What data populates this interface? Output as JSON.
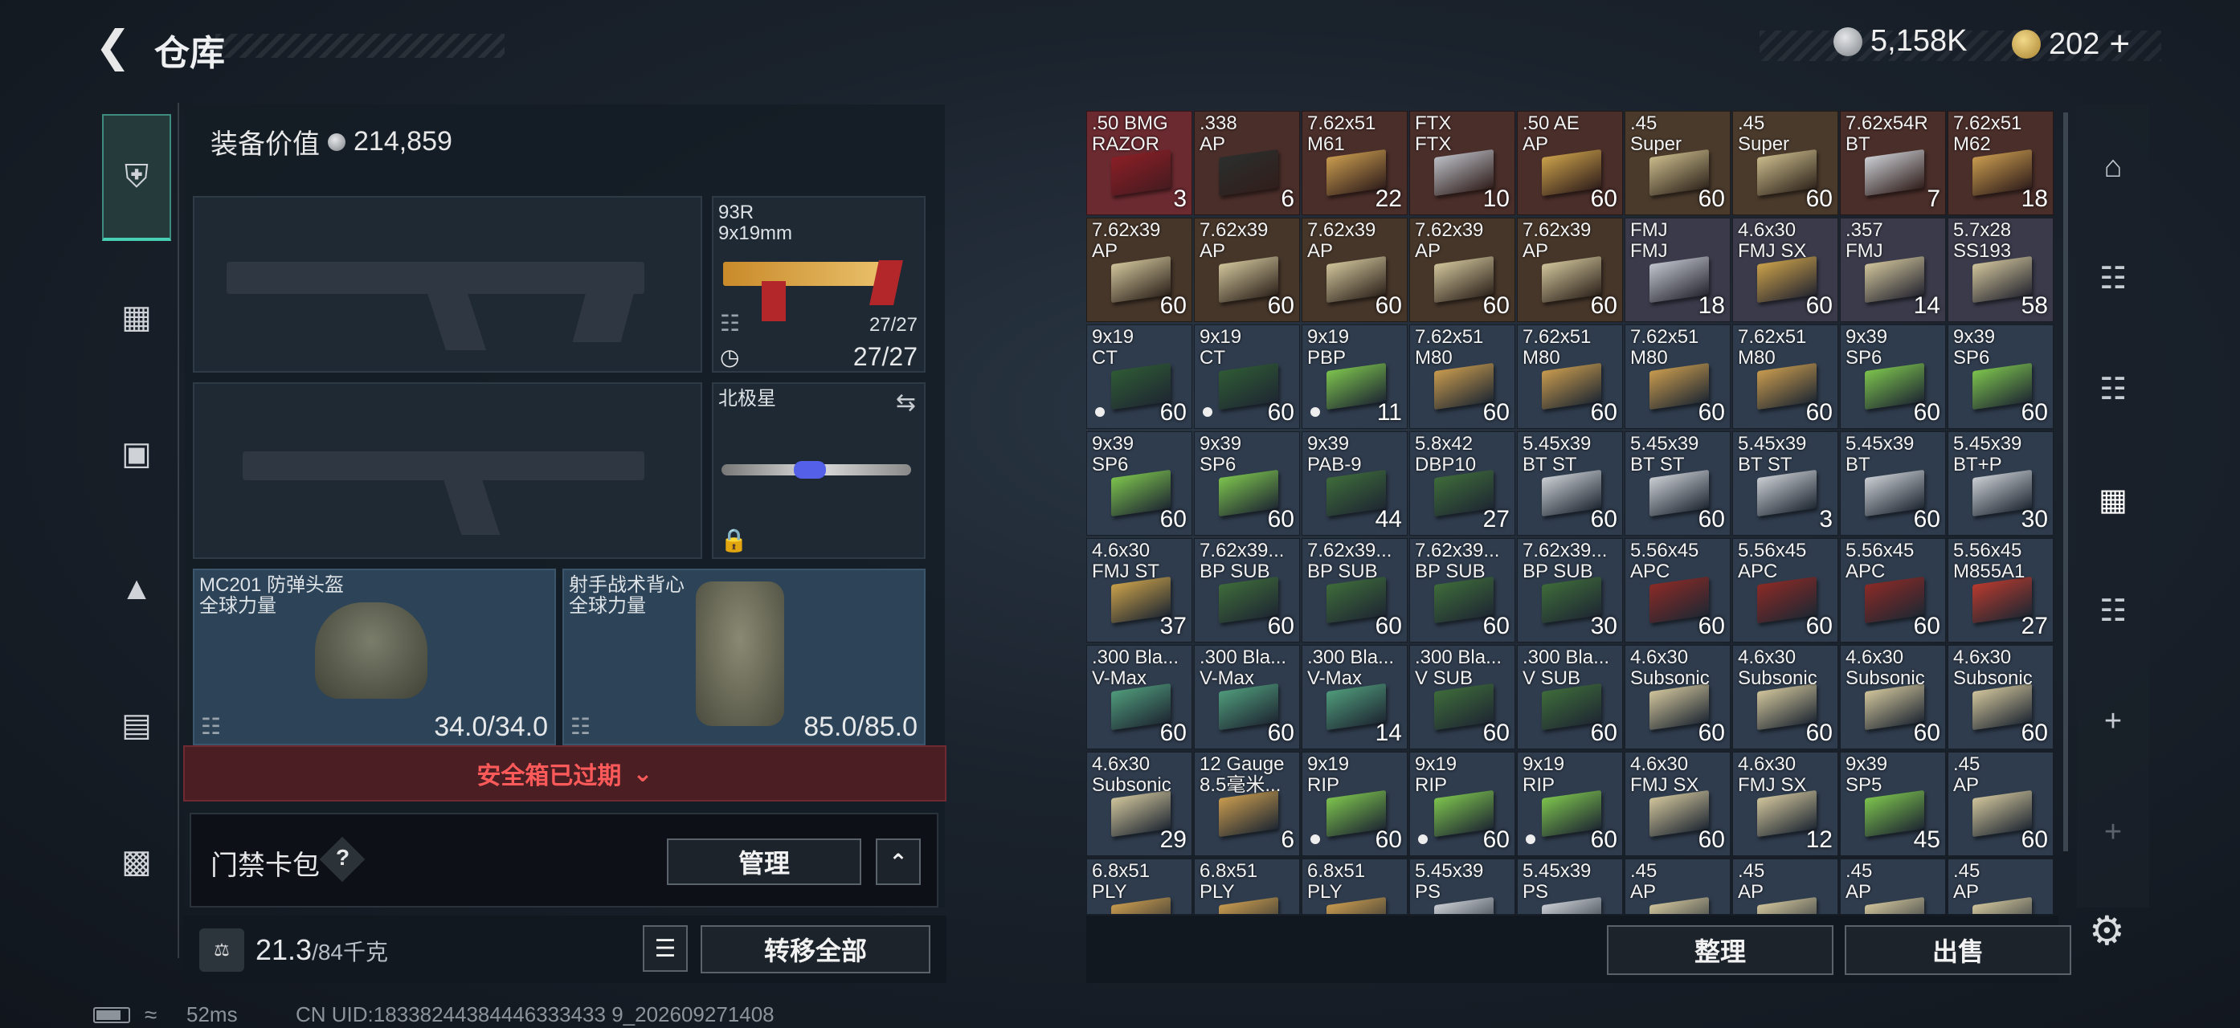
{
  "header": {
    "title": "仓库",
    "currency1": "5,158K",
    "currency2": "202"
  },
  "equipment": {
    "value_label": "装备价值",
    "value": "214,859",
    "pistol": {
      "name1": "93R",
      "name2": "9x19mm",
      "ammo_small": "27/27",
      "ammo": "27/27"
    },
    "melee": {
      "name": "北极星"
    },
    "helmet": {
      "name": "MC201 防弹头盔",
      "brand": "全球力量",
      "durability": "34.0/34.0"
    },
    "vest": {
      "name": "射手战术背心",
      "brand": "全球力量",
      "durability": "85.0/85.0"
    },
    "safe_box": "安全箱已过期",
    "access_card": "门禁卡包",
    "access_help": "?",
    "manage": "管理",
    "weight": "21.3",
    "weight_max": "/84千克",
    "transfer_all": "转移全部"
  },
  "actions": {
    "organize": "整理",
    "sell": "出售"
  },
  "status": {
    "ping": "52ms",
    "uid": "CN UID:18338244384446333433 9_202609271408"
  },
  "colors": {
    "accent": "#47d0b3",
    "danger": "#ff5a5a"
  },
  "grid": [
    {
      "n1": ".50 BMG",
      "n2": "RAZOR",
      "q": "3",
      "bg": "#6b2a30",
      "c": "#8b1e26"
    },
    {
      "n1": ".338",
      "n2": "AP",
      "q": "6",
      "bg": "#4a2e2a",
      "c": "#2b2f2d"
    },
    {
      "n1": "7.62x51",
      "n2": "M61",
      "q": "22",
      "bg": "#4a2e2a",
      "c": "#c79a4e"
    },
    {
      "n1": "FTX",
      "n2": "FTX",
      "q": "10",
      "bg": "#4a2e2a",
      "c": "#b9bdc4"
    },
    {
      "n1": ".50 AE",
      "n2": "AP",
      "q": "60",
      "bg": "#4a2e2a",
      "c": "#c9a04a"
    },
    {
      "n1": ".45",
      "n2": "Super",
      "q": "60",
      "bg": "#4a3a2c",
      "c": "#c8b98a"
    },
    {
      "n1": ".45",
      "n2": "Super",
      "q": "60",
      "bg": "#4a3a2c",
      "c": "#c8b98a"
    },
    {
      "n1": "7.62x54R",
      "n2": "BT",
      "q": "7",
      "bg": "#4a2e2a",
      "c": "#c9cdd2"
    },
    {
      "n1": "7.62x51",
      "n2": "M62",
      "q": "18",
      "bg": "#4a2e2a",
      "c": "#c79a4e"
    },
    {
      "n1": "7.62x39",
      "n2": "AP",
      "q": "60",
      "bg": "#46362a",
      "c": "#cfc39a"
    },
    {
      "n1": "7.62x39",
      "n2": "AP",
      "q": "60",
      "bg": "#46362a",
      "c": "#cfc39a"
    },
    {
      "n1": "7.62x39",
      "n2": "AP",
      "q": "60",
      "bg": "#46362a",
      "c": "#cfc39a"
    },
    {
      "n1": "7.62x39",
      "n2": "AP",
      "q": "60",
      "bg": "#46362a",
      "c": "#cfc39a"
    },
    {
      "n1": "7.62x39",
      "n2": "AP",
      "q": "60",
      "bg": "#46362a",
      "c": "#cfc39a"
    },
    {
      "n1": "FMJ",
      "n2": "FMJ",
      "q": "18",
      "bg": "#3a3a4a",
      "c": "#bfc3cc"
    },
    {
      "n1": "4.6x30",
      "n2": "FMJ SX",
      "q": "60",
      "bg": "#3a3a4a",
      "c": "#c9a04a"
    },
    {
      "n1": ".357",
      "n2": "FMJ",
      "q": "14",
      "bg": "#3a3a4a",
      "c": "#cfc39a"
    },
    {
      "n1": "5.7x28",
      "n2": "SS193",
      "q": "58",
      "bg": "#3a3a4a",
      "c": "#cfc39a"
    },
    {
      "n1": "9x19",
      "n2": "CT",
      "q": "60",
      "bg": "#2f3c4d",
      "c": "#2f5a34",
      "dot": true
    },
    {
      "n1": "9x19",
      "n2": "CT",
      "q": "60",
      "bg": "#2f3c4d",
      "c": "#2f5a34",
      "dot": true
    },
    {
      "n1": "9x19",
      "n2": "PBP",
      "q": "11",
      "bg": "#2f3c4d",
      "c": "#7cc24d",
      "dot": true
    },
    {
      "n1": "7.62x51",
      "n2": "M80",
      "q": "60",
      "bg": "#2f3c4d",
      "c": "#c79a4e"
    },
    {
      "n1": "7.62x51",
      "n2": "M80",
      "q": "60",
      "bg": "#2f3c4d",
      "c": "#c79a4e"
    },
    {
      "n1": "7.62x51",
      "n2": "M80",
      "q": "60",
      "bg": "#2f3c4d",
      "c": "#c79a4e"
    },
    {
      "n1": "7.62x51",
      "n2": "M80",
      "q": "60",
      "bg": "#2f3c4d",
      "c": "#c79a4e"
    },
    {
      "n1": "9x39",
      "n2": "SP6",
      "q": "60",
      "bg": "#2f3c4d",
      "c": "#7cc24d"
    },
    {
      "n1": "9x39",
      "n2": "SP6",
      "q": "60",
      "bg": "#2f3c4d",
      "c": "#7cc24d"
    },
    {
      "n1": "9x39",
      "n2": "SP6",
      "q": "60",
      "bg": "#2f3c4d",
      "c": "#7cc24d"
    },
    {
      "n1": "9x39",
      "n2": "SP6",
      "q": "60",
      "bg": "#2f3c4d",
      "c": "#7cc24d"
    },
    {
      "n1": "9x39",
      "n2": "PAB-9",
      "q": "44",
      "bg": "#2f3c4d",
      "c": "#3e6b3a"
    },
    {
      "n1": "5.8x42",
      "n2": "DBP10",
      "q": "27",
      "bg": "#2f3c4d",
      "c": "#3e6b3a"
    },
    {
      "n1": "5.45x39",
      "n2": "BT ST",
      "q": "60",
      "bg": "#2f3c4d",
      "c": "#c9cdd2"
    },
    {
      "n1": "5.45x39",
      "n2": "BT ST",
      "q": "60",
      "bg": "#2f3c4d",
      "c": "#c9cdd2"
    },
    {
      "n1": "5.45x39",
      "n2": "BT ST",
      "q": "3",
      "bg": "#2f3c4d",
      "c": "#c9cdd2"
    },
    {
      "n1": "5.45x39",
      "n2": "BT",
      "q": "60",
      "bg": "#2f3c4d",
      "c": "#c9cdd2"
    },
    {
      "n1": "5.45x39",
      "n2": "BT+P",
      "q": "30",
      "bg": "#2f3c4d",
      "c": "#c9cdd2"
    },
    {
      "n1": "4.6x30",
      "n2": "FMJ ST",
      "q": "37",
      "bg": "#2f3c4d",
      "c": "#c9a04a"
    },
    {
      "n1": "7.62x39...",
      "n2": "BP SUB",
      "q": "60",
      "bg": "#2f3c4d",
      "c": "#3e6b3a"
    },
    {
      "n1": "7.62x39...",
      "n2": "BP SUB",
      "q": "60",
      "bg": "#2f3c4d",
      "c": "#3e6b3a"
    },
    {
      "n1": "7.62x39...",
      "n2": "BP SUB",
      "q": "60",
      "bg": "#2f3c4d",
      "c": "#3e6b3a"
    },
    {
      "n1": "7.62x39...",
      "n2": "BP SUB",
      "q": "30",
      "bg": "#2f3c4d",
      "c": "#3e6b3a"
    },
    {
      "n1": "5.56x45",
      "n2": "APC",
      "q": "60",
      "bg": "#2f3c4d",
      "c": "#8a2a26"
    },
    {
      "n1": "5.56x45",
      "n2": "APC",
      "q": "60",
      "bg": "#2f3c4d",
      "c": "#8a2a26"
    },
    {
      "n1": "5.56x45",
      "n2": "APC",
      "q": "60",
      "bg": "#2f3c4d",
      "c": "#8a2a26"
    },
    {
      "n1": "5.56x45",
      "n2": "M855A1",
      "q": "27",
      "bg": "#2f3c4d",
      "c": "#b63a2e"
    },
    {
      "n1": ".300 Bla...",
      "n2": "V-Max",
      "q": "60",
      "bg": "#2f3c4d",
      "c": "#4f9a7a"
    },
    {
      "n1": ".300 Bla...",
      "n2": "V-Max",
      "q": "60",
      "bg": "#2f3c4d",
      "c": "#4f9a7a"
    },
    {
      "n1": ".300 Bla...",
      "n2": "V-Max",
      "q": "14",
      "bg": "#2f3c4d",
      "c": "#4f9a7a"
    },
    {
      "n1": ".300 Bla...",
      "n2": "V SUB",
      "q": "60",
      "bg": "#2f3c4d",
      "c": "#3e6b3a"
    },
    {
      "n1": ".300 Bla...",
      "n2": "V SUB",
      "q": "60",
      "bg": "#2f3c4d",
      "c": "#3e6b3a"
    },
    {
      "n1": "4.6x30",
      "n2": "Subsonic",
      "q": "60",
      "bg": "#2f3c4d",
      "c": "#cfc39a"
    },
    {
      "n1": "4.6x30",
      "n2": "Subsonic",
      "q": "60",
      "bg": "#2f3c4d",
      "c": "#cfc39a"
    },
    {
      "n1": "4.6x30",
      "n2": "Subsonic",
      "q": "60",
      "bg": "#2f3c4d",
      "c": "#cfc39a"
    },
    {
      "n1": "4.6x30",
      "n2": "Subsonic",
      "q": "60",
      "bg": "#2f3c4d",
      "c": "#cfc39a"
    },
    {
      "n1": "4.6x30",
      "n2": "Subsonic",
      "q": "29",
      "bg": "#2f3c4d",
      "c": "#cfc39a"
    },
    {
      "n1": "12 Gauge",
      "n2": "8.5毫米...",
      "q": "6",
      "bg": "#2f3c4d",
      "c": "#c79a4e"
    },
    {
      "n1": "9x19",
      "n2": "RIP",
      "q": "60",
      "bg": "#2f3c4d",
      "c": "#7cc24d",
      "dot": true
    },
    {
      "n1": "9x19",
      "n2": "RIP",
      "q": "60",
      "bg": "#2f3c4d",
      "c": "#7cc24d",
      "dot": true
    },
    {
      "n1": "9x19",
      "n2": "RIP",
      "q": "60",
      "bg": "#2f3c4d",
      "c": "#7cc24d",
      "dot": true
    },
    {
      "n1": "4.6x30",
      "n2": "FMJ SX",
      "q": "60",
      "bg": "#2f3c4d",
      "c": "#cfc39a"
    },
    {
      "n1": "4.6x30",
      "n2": "FMJ SX",
      "q": "12",
      "bg": "#2f3c4d",
      "c": "#cfc39a"
    },
    {
      "n1": "9x39",
      "n2": "SP5",
      "q": "45",
      "bg": "#2f3c4d",
      "c": "#7cc24d"
    },
    {
      "n1": ".45",
      "n2": "AP",
      "q": "60",
      "bg": "#2f3c4d",
      "c": "#cfc39a"
    },
    {
      "n1": "6.8x51",
      "n2": "PLY",
      "q": "",
      "bg": "#2f3c4d",
      "c": "#c79a4e"
    },
    {
      "n1": "6.8x51",
      "n2": "PLY",
      "q": "",
      "bg": "#2f3c4d",
      "c": "#c79a4e"
    },
    {
      "n1": "6.8x51",
      "n2": "PLY",
      "q": "",
      "bg": "#2f3c4d",
      "c": "#c79a4e"
    },
    {
      "n1": "5.45x39",
      "n2": "PS",
      "q": "",
      "bg": "#2f3c4d",
      "c": "#c9cdd2"
    },
    {
      "n1": "5.45x39",
      "n2": "PS",
      "q": "",
      "bg": "#2f3c4d",
      "c": "#c9cdd2"
    },
    {
      "n1": ".45",
      "n2": "AP",
      "q": "",
      "bg": "#2f3c4d",
      "c": "#cfc39a"
    },
    {
      "n1": ".45",
      "n2": "AP",
      "q": "",
      "bg": "#2f3c4d",
      "c": "#cfc39a"
    },
    {
      "n1": ".45",
      "n2": "AP",
      "q": "",
      "bg": "#2f3c4d",
      "c": "#cfc39a"
    },
    {
      "n1": ".45",
      "n2": "AP",
      "q": "",
      "bg": "#2f3c4d",
      "c": "#cfc39a"
    }
  ]
}
